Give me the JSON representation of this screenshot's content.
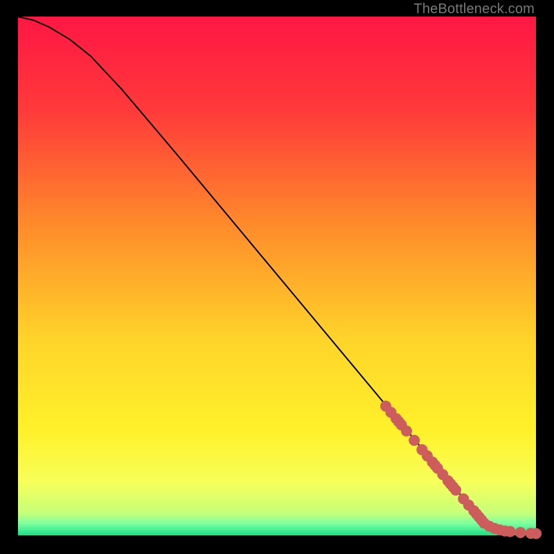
{
  "watermark": "TheBottleneck.com",
  "chart_data": {
    "type": "line",
    "title": "",
    "xlabel": "",
    "ylabel": "",
    "xlim": [
      0,
      100
    ],
    "ylim": [
      0,
      100
    ],
    "curve": {
      "x": [
        0,
        3,
        6,
        10,
        14,
        20,
        30,
        40,
        50,
        60,
        70,
        80,
        85,
        88,
        90,
        92,
        95,
        98,
        100
      ],
      "y": [
        100,
        99.3,
        98,
        95.6,
        92.4,
        86.0,
        74.2,
        62.2,
        50.2,
        38.2,
        26.2,
        14.2,
        8.2,
        4.6,
        2.2,
        1.2,
        0.6,
        0.3,
        0.2
      ]
    },
    "points_on_curve": {
      "x": [
        71,
        72,
        73,
        73.5,
        74,
        75,
        76.5,
        78,
        79,
        80,
        80.5,
        81,
        82,
        83,
        83.5,
        84,
        84.5,
        86,
        87,
        88,
        88.5,
        89,
        89.5,
        90,
        91,
        92,
        93,
        94,
        95,
        97,
        99,
        100
      ],
      "y": [
        24.8,
        23.6,
        22.4,
        21.8,
        21.2,
        20.0,
        18.2,
        16.4,
        15.2,
        14.0,
        13.4,
        12.8,
        11.6,
        10.4,
        9.8,
        9.2,
        8.6,
        6.9,
        5.7,
        4.6,
        4.0,
        3.4,
        2.8,
        2.2,
        1.6,
        1.2,
        0.9,
        0.7,
        0.6,
        0.4,
        0.25,
        0.2
      ]
    },
    "gradient_stops": [
      {
        "h_pct": 0,
        "color": "#ff1744"
      },
      {
        "h_pct": 18,
        "color": "#ff3a3a"
      },
      {
        "h_pct": 40,
        "color": "#ff8a2b"
      },
      {
        "h_pct": 62,
        "color": "#ffd32a"
      },
      {
        "h_pct": 80,
        "color": "#fff12a"
      },
      {
        "h_pct": 90,
        "color": "#f7ff5a"
      },
      {
        "h_pct": 96,
        "color": "#c6ff7a"
      },
      {
        "h_pct": 98,
        "color": "#7dffa0"
      },
      {
        "h_pct": 100,
        "color": "#25e28a"
      }
    ],
    "point_color": "#cd5c5c",
    "curve_color": "#000000"
  }
}
